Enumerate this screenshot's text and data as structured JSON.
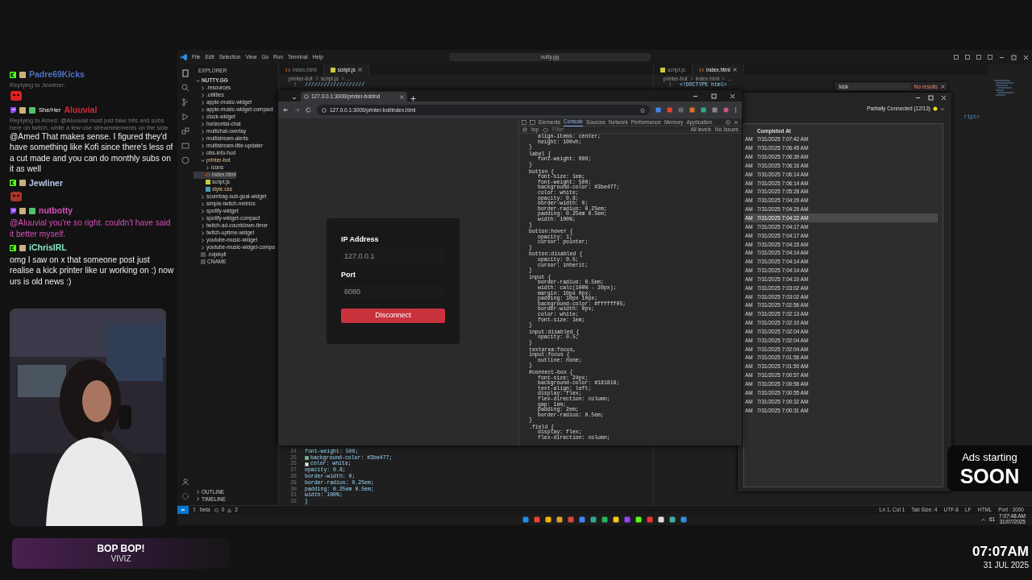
{
  "chat": {
    "messages": [
      {
        "kind": "kick",
        "username": "Padre69Kicks",
        "color": "#4f6fc4",
        "reply": "Replying to Jewliner:",
        "emote": true
      },
      {
        "kind": "twitch",
        "pronoun": "She/Her",
        "username": "Aluuvial",
        "color": "#d42a3a",
        "reply": "Replying to Amed: @Aluuvial most just take bits and subs here on twitch, while a few use streamelements on the side",
        "emote": false,
        "text": "@Amed That makes sense. I figured they'd have something like Kofi since there's less of a cut made and you can do monthly subs on it as well",
        "tinted": false
      },
      {
        "kind": "kick",
        "username": "Jewliner",
        "color": "#b4c8ea",
        "emote": true
      },
      {
        "kind": "twitch",
        "username": "nutbotty",
        "color": "#d651b9",
        "emote": false,
        "text": "@Aluuvial you're so right. couldn't have said it better myself.",
        "tinted": true
      },
      {
        "kind": "kick",
        "username": "iChrisIRL",
        "color": "#86e6c0",
        "emote": false,
        "text": "omg I saw on x that someone post just realise a kick printer like ur working on :) now urs is old news :)",
        "tinted": false
      }
    ]
  },
  "now_playing": {
    "title": "BOP BOP!",
    "artist": "VIVIZ"
  },
  "ads_notice": {
    "line_1": "Ads starting",
    "line_2": "SOON"
  },
  "clock": {
    "time": "07:07AM",
    "date": "31 JUL 2025"
  },
  "editor": {
    "menu": [
      "File",
      "Edit",
      "Selection",
      "View",
      "Go",
      "Run",
      "Terminal",
      "Help"
    ],
    "search": "nutty.gg",
    "explorer": {
      "title": "EXPLORER",
      "root": "NUTTY.GG",
      "items": [
        {
          "label": ".resources",
          "kind": "folder",
          "expanded": false,
          "selected": false,
          "modified": false
        },
        {
          "label": ".utilities",
          "kind": "folder",
          "expanded": false,
          "selected": false,
          "modified": false
        },
        {
          "label": "apple-music-widget",
          "kind": "folder",
          "expanded": false,
          "selected": false,
          "modified": false
        },
        {
          "label": "apple-music-widget-compact",
          "kind": "folder",
          "expanded": false,
          "selected": false,
          "modified": false
        },
        {
          "label": "clock-widget",
          "kind": "folder",
          "expanded": false,
          "selected": false,
          "modified": false
        },
        {
          "label": "horizontal-chat",
          "kind": "folder",
          "expanded": false,
          "selected": false,
          "modified": false
        },
        {
          "label": "multichat-overlay",
          "kind": "folder",
          "expanded": false,
          "selected": false,
          "modified": false
        },
        {
          "label": "multistream-alerts",
          "kind": "folder",
          "expanded": false,
          "selected": false,
          "modified": false
        },
        {
          "label": "multistream-title-updater",
          "kind": "folder",
          "expanded": false,
          "selected": false,
          "modified": false
        },
        {
          "label": "obs-info-hud",
          "kind": "folder",
          "expanded": false,
          "selected": false,
          "modified": false
        },
        {
          "label": "printer-bot",
          "kind": "folder",
          "expanded": true,
          "selected": false,
          "modified": true,
          "children": [
            {
              "label": "icons",
              "kind": "folder",
              "expanded": false,
              "selected": false,
              "modified": false
            },
            {
              "label": "index.html",
              "kind": "html",
              "selected": true,
              "modified": false
            },
            {
              "label": "script.js",
              "kind": "js",
              "selected": false,
              "modified": false
            },
            {
              "label": "style.css",
              "kind": "css",
              "selected": false,
              "modified": true
            }
          ]
        },
        {
          "label": "scumbag-sub-goal-widget",
          "kind": "folder",
          "expanded": false,
          "selected": false,
          "modified": false
        },
        {
          "label": "simple-twitch-metrics",
          "kind": "folder",
          "expanded": false,
          "selected": false,
          "modified": false
        },
        {
          "label": "spotify-widget",
          "kind": "folder",
          "expanded": false,
          "selected": false,
          "modified": false
        },
        {
          "label": "spotify-widget-compact",
          "kind": "folder",
          "expanded": false,
          "selected": false,
          "modified": false
        },
        {
          "label": "twitch-ad-countdown-timer",
          "kind": "folder",
          "expanded": false,
          "selected": false,
          "modified": false
        },
        {
          "label": "twitch-uptime-widget",
          "kind": "folder",
          "expanded": false,
          "selected": false,
          "modified": false
        },
        {
          "label": "youtube-music-widget",
          "kind": "folder",
          "expanded": false,
          "selected": false,
          "modified": false
        },
        {
          "label": "youtube-music-widget-compa",
          "kind": "folder",
          "expanded": false,
          "selected": false,
          "modified": false
        },
        {
          "label": ".nojekyll",
          "kind": "file",
          "selected": false,
          "modified": false
        },
        {
          "label": "CNAME",
          "kind": "file",
          "selected": false,
          "modified": false
        }
      ]
    },
    "panels": [
      "OUTLINE",
      "TIMELINE"
    ],
    "groups": [
      {
        "tabs": [
          {
            "label": "index.html",
            "kind": "html",
            "selected": false
          },
          {
            "label": "script.js",
            "kind": "js",
            "selected": true
          }
        ],
        "breadcrumb": [
          "printer-bot",
          "script.js",
          "..."
        ],
        "top_lines": [
          {
            "number": "1",
            "text": "///////////////////"
          }
        ],
        "bottom_lines": [
          {
            "number": "24",
            "text": "font-weight: 500;"
          },
          {
            "number": "25",
            "text": "background-color: #3be477;",
            "color": "#3be477"
          },
          {
            "number": "26",
            "text": "color: white;",
            "color": "#ffffff"
          },
          {
            "number": "27",
            "text": "opacity: 0.8;"
          },
          {
            "number": "28",
            "text": "border-width: 0;"
          },
          {
            "number": "29",
            "text": "border-radius: 0.25em;"
          },
          {
            "number": "30",
            "text": "padding: 0.25em 0.5em;"
          },
          {
            "number": "31",
            "text": "width: 100%;"
          },
          {
            "number": "32",
            "text": "}"
          }
        ]
      },
      {
        "tabs": [
          {
            "label": "script.js",
            "kind": "js",
            "selected": false
          },
          {
            "label": "index.html",
            "kind": "html",
            "selected": true
          }
        ],
        "breadcrumb": [
          "printer-bot",
          "index.html",
          "..."
        ],
        "top_lines": [
          {
            "number": "1",
            "text": "<!DOCTYPE html>"
          }
        ],
        "fragment": "ript>",
        "find": {
          "value": "kick",
          "result": "No results"
        }
      }
    ],
    "status_bar": {
      "branch": "beta",
      "errors": "0",
      "warnings": "2",
      "right": [
        "Ln 1, Col 1",
        "Tab Size: 4",
        "UTF-8",
        "LF",
        "HTML",
        "Port : 3000"
      ]
    },
    "taskbar": {
      "tray_count": "61",
      "time": "7:07:48 AM",
      "date": "31/07/2025"
    }
  },
  "browser": {
    "tab": "127.0.0.1:3000/printer-bot/ind",
    "address": "127.0.0.1:3000/printer-bot/index.html",
    "page": {
      "fields": [
        {
          "label": "IP Address",
          "value": "127.0.0.1",
          "disabled": true
        },
        {
          "label": "Port",
          "value": "8080",
          "disabled": true
        }
      ],
      "button": "Disconnect"
    },
    "devtools": {
      "tabs": [
        {
          "label": "Elements",
          "selected": false
        },
        {
          "label": "Console",
          "selected": true
        },
        {
          "label": "Sources",
          "selected": false
        },
        {
          "label": "Network",
          "selected": false
        },
        {
          "label": "Performance",
          "selected": false
        },
        {
          "label": "Memory",
          "selected": false
        },
        {
          "label": "Application",
          "selected": false
        }
      ],
      "context": "top",
      "filter_placeholder": "Filter",
      "levels": "All levels",
      "issues": "No Issues",
      "blocks": [
        {
          "declarations": [
            "align-items: center;",
            "height: 100vh;"
          ],
          "end": "}"
        },
        {
          "selector_lines": [
            "label {"
          ],
          "declarations": [
            "font-weight: 600;"
          ],
          "end": "}"
        },
        {
          "selector_lines": [
            "button {"
          ],
          "declarations": [
            "font-size: 1em;",
            "font-weight: 500;",
            "background-color: #3be477;",
            "color: white;",
            "opacity: 0.8;",
            "border-width: 0;",
            "border-radius: 0.25em;",
            "padding: 0.25em 0.5em;",
            "width: 100%;"
          ],
          "end": "}"
        },
        {
          "selector_lines": [
            "button:hover {"
          ],
          "declarations": [
            "opacity: 1;",
            "cursor: pointer;"
          ],
          "end": "}"
        },
        {
          "selector_lines": [
            "button:disabled {"
          ],
          "declarations": [
            "opacity: 0.5;",
            "cursor: inherit;"
          ],
          "end": "}"
        },
        {
          "selector_lines": [
            "input {"
          ],
          "declarations": [
            "border-radius: 0.5em;",
            "width: calc(100% - 20px);",
            "margin: 10px 0px;",
            "padding: 10px 10px;",
            "background-color: #ffffff05;",
            "border-width: 0px;",
            "color: white;",
            "font-size: 1em;"
          ],
          "end": "}"
        },
        {
          "selector_lines": [
            "input:disabled {"
          ],
          "declarations": [
            "opacity: 0.5;"
          ],
          "end": "}"
        },
        {
          "selector_lines": [
            "textarea:focus,",
            "input:focus {"
          ],
          "declarations": [
            "outline: none;"
          ],
          "end": "}"
        },
        {
          "selector_lines": [
            "#connect-box {"
          ],
          "declarations": [
            "font-size: 24px;",
            "background-color: #181818;",
            "text-align: left;",
            "display: flex;",
            "flex-direction: column;",
            "gap: 1em;",
            "padding: 2em;",
            "border-radius: 0.5em;"
          ],
          "end": "}"
        },
        {
          "selector_lines": [
            ".field {"
          ],
          "declarations": [
            "display: flex;",
            "flex-direction: column;"
          ]
        }
      ]
    }
  },
  "queue_app": {
    "status": {
      "text": "Partially Connected (12/13)",
      "color": "#f2d61c"
    },
    "table": {
      "columns": [
        "Completed At"
      ],
      "rows": [
        {
          "column_1": "AM",
          "completed_at": "7/31/2025 7:07:42 AM",
          "selected": false
        },
        {
          "column_1": "AM",
          "completed_at": "7/31/2025 7:06:45 AM",
          "selected": false
        },
        {
          "column_1": "AM",
          "completed_at": "7/31/2025 7:06:39 AM",
          "selected": false
        },
        {
          "column_1": "AM",
          "completed_at": "7/31/2025 7:06:16 AM",
          "selected": false
        },
        {
          "column_1": "AM",
          "completed_at": "7/31/2025 7:06:14 AM",
          "selected": false
        },
        {
          "column_1": "AM",
          "completed_at": "7/31/2025 7:06:14 AM",
          "selected": false
        },
        {
          "column_1": "AM",
          "completed_at": "7/31/2025 7:05:28 AM",
          "selected": false
        },
        {
          "column_1": "AM",
          "completed_at": "7/31/2025 7:04:29 AM",
          "selected": false
        },
        {
          "column_1": "AM",
          "completed_at": "7/31/2025 7:04:29 AM",
          "selected": false
        },
        {
          "column_1": "AM",
          "completed_at": "7/31/2025 7:04:22 AM",
          "selected": true
        },
        {
          "column_1": "AM",
          "completed_at": "7/31/2025 7:04:17 AM",
          "selected": false
        },
        {
          "column_1": "AM",
          "completed_at": "7/31/2025 7:04:17 AM",
          "selected": false
        },
        {
          "column_1": "AM",
          "completed_at": "7/31/2025 7:04:15 AM",
          "selected": false
        },
        {
          "column_1": "AM",
          "completed_at": "7/31/2025 7:04:14 AM",
          "selected": false
        },
        {
          "column_1": "AM",
          "completed_at": "7/31/2025 7:04:14 AM",
          "selected": false
        },
        {
          "column_1": "AM",
          "completed_at": "7/31/2025 7:04:14 AM",
          "selected": false
        },
        {
          "column_1": "AM",
          "completed_at": "7/31/2025 7:04:10 AM",
          "selected": false
        },
        {
          "column_1": "AM",
          "completed_at": "7/31/2025 7:03:02 AM",
          "selected": false
        },
        {
          "column_1": "AM",
          "completed_at": "7/31/2025 7:03:02 AM",
          "selected": false
        },
        {
          "column_1": "AM",
          "completed_at": "7/31/2025 7:02:56 AM",
          "selected": false
        },
        {
          "column_1": "AM",
          "completed_at": "7/31/2025 7:02:13 AM",
          "selected": false
        },
        {
          "column_1": "AM",
          "completed_at": "7/31/2025 7:02:10 AM",
          "selected": false
        },
        {
          "column_1": "AM",
          "completed_at": "7/31/2025 7:02:04 AM",
          "selected": false
        },
        {
          "column_1": "AM",
          "completed_at": "7/31/2025 7:02:04 AM",
          "selected": false
        },
        {
          "column_1": "AM",
          "completed_at": "7/31/2025 7:02:04 AM",
          "selected": false
        },
        {
          "column_1": "AM",
          "completed_at": "7/31/2025 7:01:56 AM",
          "selected": false
        },
        {
          "column_1": "AM",
          "completed_at": "7/31/2025 7:01:50 AM",
          "selected": false
        },
        {
          "column_1": "AM",
          "completed_at": "7/31/2025 7:00:57 AM",
          "selected": false
        },
        {
          "column_1": "AM",
          "completed_at": "7/31/2025 7:00:56 AM",
          "selected": false
        },
        {
          "column_1": "AM",
          "completed_at": "7/31/2025 7:00:55 AM",
          "selected": false
        },
        {
          "column_1": "AM",
          "completed_at": "7/31/2025 7:00:32 AM",
          "selected": false
        },
        {
          "column_1": "AM",
          "completed_at": "7/31/2025 7:00:31 AM",
          "selected": false
        }
      ]
    }
  }
}
